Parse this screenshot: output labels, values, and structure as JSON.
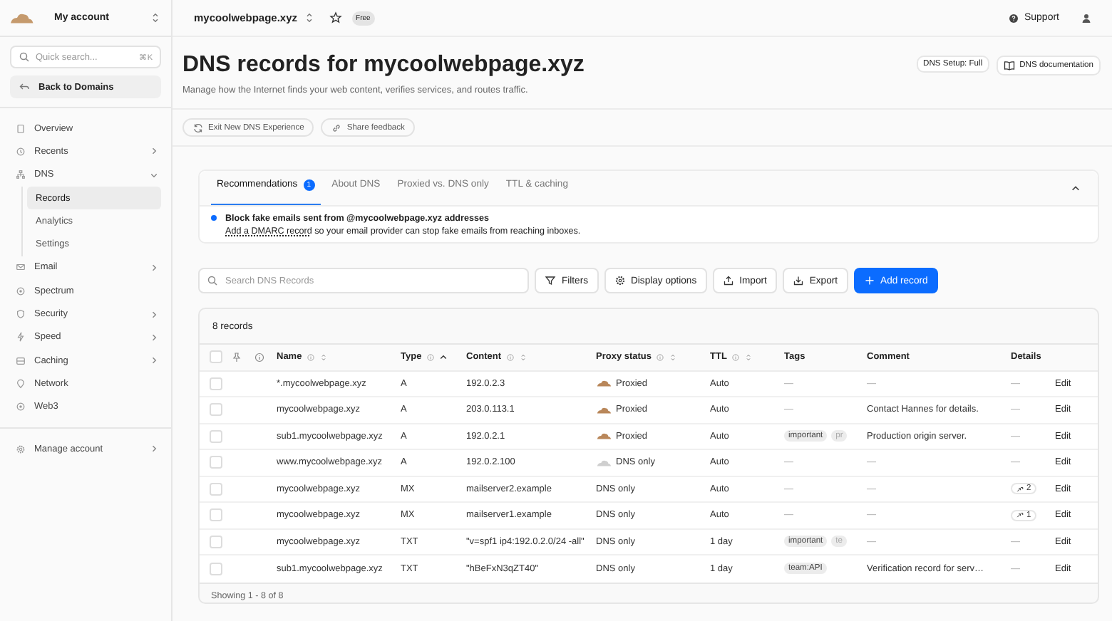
{
  "sidebar": {
    "account": "My account",
    "search": {
      "placeholder": "Quick search...",
      "shortcut": "⌘K"
    },
    "back": "Back to Domains",
    "items": [
      {
        "label": "Overview",
        "selected": false
      },
      {
        "label": "Recents",
        "selected": false,
        "expanded": false
      },
      {
        "label": "DNS",
        "selected": false,
        "expanded": true,
        "children": [
          {
            "label": "Records",
            "selected": true
          },
          {
            "label": "Analytics",
            "selected": false
          },
          {
            "label": "Settings",
            "selected": false
          }
        ]
      },
      {
        "label": "Email",
        "selected": false,
        "expanded": false
      },
      {
        "label": "Spectrum",
        "selected": false
      },
      {
        "label": "Security",
        "selected": false,
        "expanded": false
      },
      {
        "label": "Speed",
        "selected": false,
        "expanded": false
      },
      {
        "label": "Caching",
        "selected": false,
        "expanded": false
      },
      {
        "label": "Network",
        "selected": false
      },
      {
        "label": "Web3",
        "selected": false
      }
    ],
    "footer_item": {
      "label": "Manage account",
      "selected": false,
      "expanded": false
    }
  },
  "topbar": {
    "domain": "mycoolwebpage.xyz",
    "plan": "Free",
    "support": "Support"
  },
  "header": {
    "title": "DNS records for mycoolwebpage.xyz",
    "subtitle": "Manage how the Internet finds your web content, verifies services, and routes traffic.",
    "setup": "DNS Setup: Full",
    "docs": "DNS documentation"
  },
  "actions": [
    "Exit New DNS Experience",
    "Share feedback"
  ],
  "recommendations": {
    "tabs": [
      {
        "label": "Recommendations",
        "selected": true,
        "badge": "1"
      },
      {
        "label": "About DNS",
        "selected": false
      },
      {
        "label": "Proxied vs. DNS only",
        "selected": false
      },
      {
        "label": "TTL & caching",
        "selected": false
      }
    ],
    "title": "Block fake emails sent from @mycoolwebpage.xyz addresses",
    "link": "Add a DMARC record",
    "text": " so your email provider can stop fake emails from reaching inboxes."
  },
  "toolbar": {
    "search": {
      "placeholder": "Search DNS Records"
    },
    "buttons": [
      {
        "label": "Filters",
        "primary": false
      },
      {
        "label": "Display options",
        "primary": false
      },
      {
        "label": "Import",
        "primary": false
      },
      {
        "label": "Export",
        "primary": false
      },
      {
        "label": "Add record",
        "primary": true
      }
    ]
  },
  "table": {
    "count": "8 records",
    "select_all": {
      "checked": false
    },
    "columns": [
      {
        "label": "Name",
        "info": true,
        "kind": "sortable"
      },
      {
        "label": "Type",
        "info": true,
        "kind": "sorted"
      },
      {
        "label": "Content",
        "info": true,
        "kind": "sortable"
      },
      {
        "label": "Proxy status",
        "info": true,
        "kind": "sortable"
      },
      {
        "label": "TTL",
        "info": true,
        "kind": "sortable"
      },
      {
        "label": "Tags",
        "info": false,
        "kind": "plain"
      },
      {
        "label": "Comment",
        "info": false,
        "kind": "plain"
      },
      {
        "label": "Details",
        "info": false,
        "kind": "plain"
      }
    ],
    "rows": [
      {
        "checked": false,
        "name": "*.mycoolwebpage.xyz",
        "type": "A",
        "content": "192.0.2.3",
        "proxy": "Proxied",
        "kind": "proxied",
        "ttl": "Auto",
        "tags_text": "—",
        "comment": "—",
        "details_text": "—",
        "edit": "Edit"
      },
      {
        "checked": false,
        "name": "mycoolwebpage.xyz",
        "type": "A",
        "content": "203.0.113.1",
        "proxy": "Proxied",
        "kind": "proxied",
        "ttl": "Auto",
        "tags_text": "—",
        "comment": "Contact Hannes for details.",
        "details_text": "—",
        "edit": "Edit"
      },
      {
        "checked": false,
        "name": "sub1.mycoolwebpage.xyz",
        "type": "A",
        "content": "192.0.2.1",
        "proxy": "Proxied",
        "kind": "proxied",
        "ttl": "Auto",
        "tags": [
          "important",
          "pr"
        ],
        "comment": "Production origin server.",
        "details_text": "—",
        "edit": "Edit"
      },
      {
        "checked": false,
        "name": "www.mycoolwebpage.xyz",
        "type": "A",
        "content": "192.0.2.100",
        "proxy": "DNS only",
        "kind": "unproxied",
        "ttl": "Auto",
        "tags_text": "—",
        "comment": "—",
        "details_text": "—",
        "edit": "Edit"
      },
      {
        "checked": false,
        "name": "mycoolwebpage.xyz",
        "type": "MX",
        "content": "mailserver2.example",
        "proxy": "DNS only",
        "kind": "plain",
        "ttl": "Auto",
        "tags_text": "—",
        "comment": "—",
        "details_count": "2",
        "edit": "Edit"
      },
      {
        "checked": false,
        "name": "mycoolwebpage.xyz",
        "type": "MX",
        "content": "mailserver1.example",
        "proxy": "DNS only",
        "kind": "plain",
        "ttl": "Auto",
        "tags_text": "—",
        "comment": "—",
        "details_count": "1",
        "edit": "Edit"
      },
      {
        "checked": false,
        "name": "mycoolwebpage.xyz",
        "type": "TXT",
        "content": "\"v=spf1 ip4:192.0.2.0/24 -all\"",
        "proxy": "DNS only",
        "kind": "plain",
        "ttl": "1 day",
        "tags": [
          "important",
          "te"
        ],
        "comment": "—",
        "details_text": "—",
        "edit": "Edit"
      },
      {
        "checked": false,
        "name": "sub1.mycoolwebpage.xyz",
        "type": "TXT",
        "content": "\"hBeFxN3qZT40\"",
        "proxy": "DNS only",
        "kind": "plain",
        "ttl": "1 day",
        "tags": [
          "team:API"
        ],
        "comment": "Verification record for serv…",
        "details_text": "—",
        "edit": "Edit"
      }
    ],
    "footer": "Showing 1 - 8 of 8"
  }
}
